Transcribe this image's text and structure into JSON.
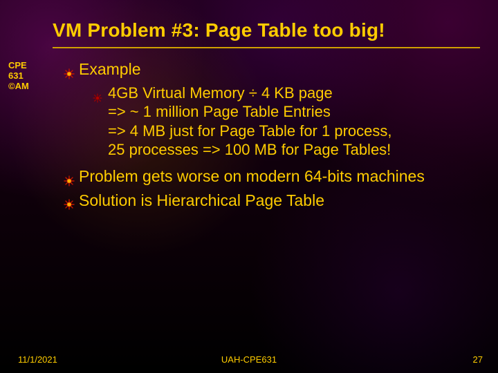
{
  "title": "VM Problem #3: Page Table too big!",
  "sidebar": {
    "line1": "CPE",
    "line2": "631",
    "line3": "AM",
    "copyright": "©"
  },
  "bullets": {
    "b0": {
      "head": "Example"
    },
    "b0_sub": {
      "l1": "4GB Virtual Memory ÷ 4 KB page",
      "l2": "=> ~ 1 million Page Table Entries",
      "l3": "=> 4 MB just for Page Table for 1 process,",
      "l4": "25 processes => 100 MB for Page Tables!"
    },
    "b1": "Problem gets worse on modern 64-bits machines",
    "b2": "Solution is Hierarchical Page Table"
  },
  "footer": {
    "date": "11/1/2021",
    "center": "UAH-CPE631",
    "page": "27"
  },
  "icons": {
    "bullet_lvl1": "sun-bullet",
    "bullet_lvl2": "sun-bullet-small"
  }
}
